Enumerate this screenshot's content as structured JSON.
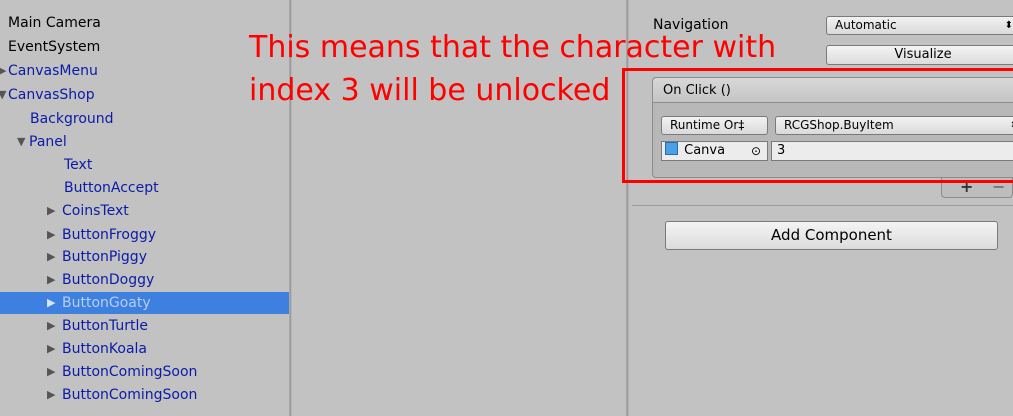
{
  "hierarchy": {
    "items": [
      {
        "label": "Main Camera",
        "arrow": ""
      },
      {
        "label": "EventSystem",
        "arrow": ""
      },
      {
        "label": "CanvasMenu",
        "arrow": "▶"
      },
      {
        "label": "CanvasShop",
        "arrow": "▼"
      },
      {
        "label": "Background",
        "arrow": ""
      },
      {
        "label": "Panel",
        "arrow": "▼"
      },
      {
        "label": "Text",
        "arrow": ""
      },
      {
        "label": "ButtonAccept",
        "arrow": ""
      },
      {
        "label": "CoinsText",
        "arrow": "▶"
      },
      {
        "label": "ButtonFroggy",
        "arrow": "▶"
      },
      {
        "label": "ButtonPiggy",
        "arrow": "▶"
      },
      {
        "label": "ButtonDoggy",
        "arrow": "▶"
      },
      {
        "label": "ButtonGoaty",
        "arrow": "▶"
      },
      {
        "label": "ButtonTurtle",
        "arrow": "▶"
      },
      {
        "label": "ButtonKoala",
        "arrow": "▶"
      },
      {
        "label": "ButtonComingSoon",
        "arrow": "▶"
      },
      {
        "label": "ButtonComingSoon",
        "arrow": "▶"
      }
    ],
    "selected": "ButtonGoaty"
  },
  "inspector": {
    "navigation_label": "Navigation",
    "navigation_value": "Automatic",
    "dropdown_arrow": "⬍",
    "visualize_label": "Visualize",
    "onclick": {
      "header": "On Click ()",
      "runtime_mode": "Runtime Or‡",
      "function": "RCGShop.BuyItem",
      "target_object": "Canva",
      "target_icon": "canvas-icon",
      "picker_icon": "⊙",
      "argument": "3",
      "add_symbol": "+",
      "remove_symbol": "−"
    },
    "add_component_label": "Add Component"
  },
  "annotation": {
    "line1": "This means that the character with",
    "line2": "index 3 will be unlocked",
    "color": "#ff0000"
  },
  "colors": {
    "selection": "#3d80df",
    "panel_bg": "#c2c2c2",
    "child_text": "#0b1ba8"
  }
}
